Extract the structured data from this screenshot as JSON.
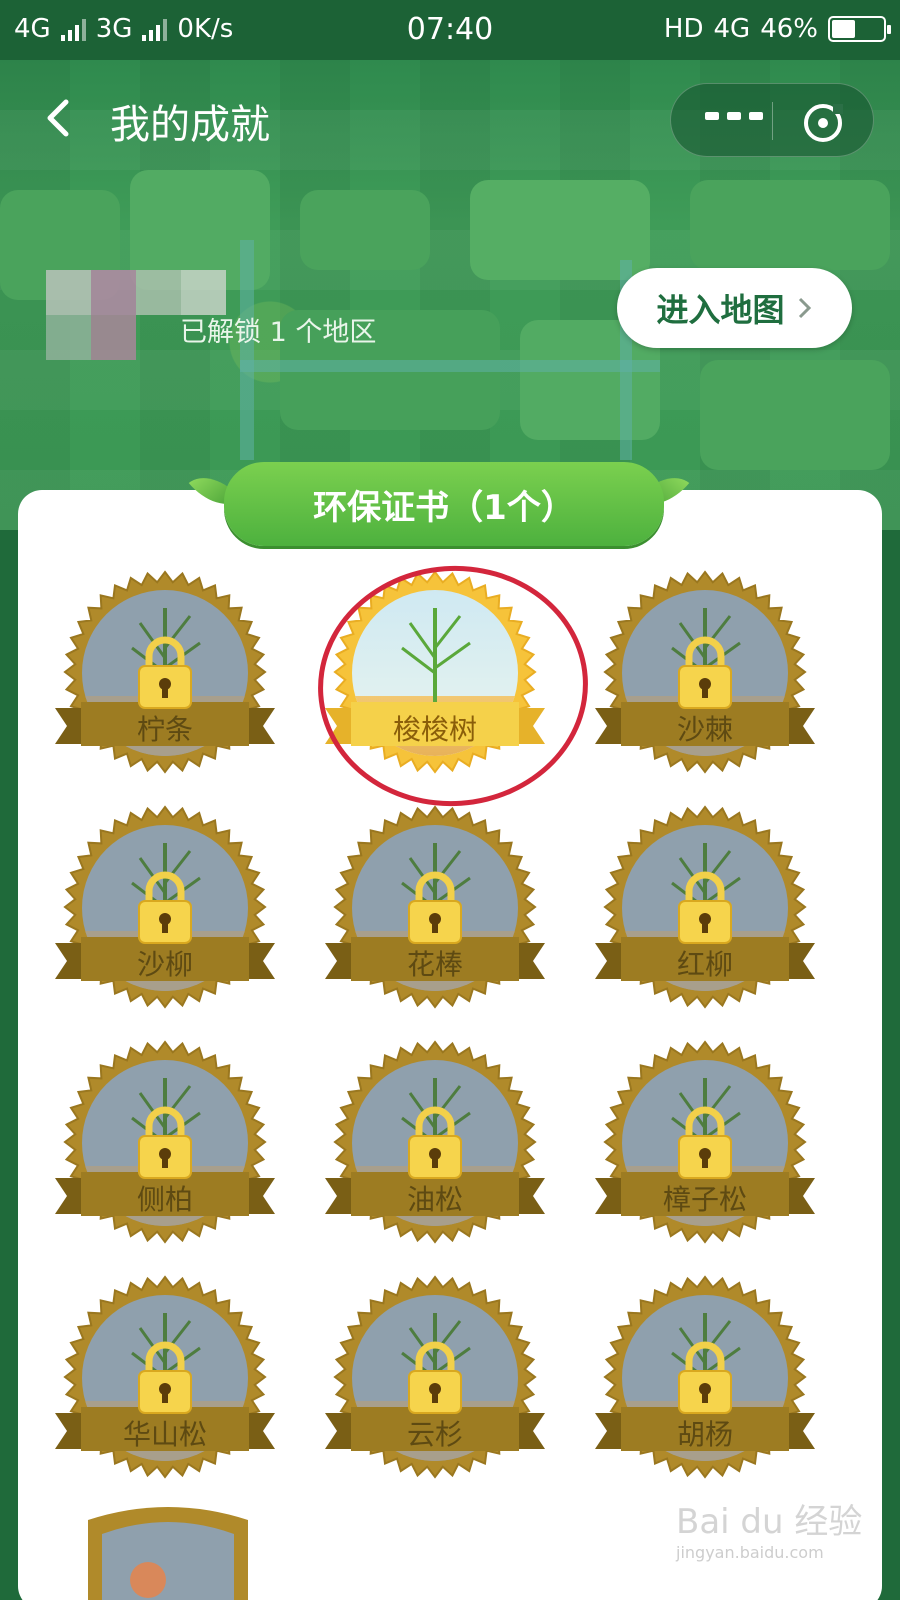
{
  "status_bar": {
    "network1": "4G",
    "network2": "3G",
    "speed": "0K/s",
    "time": "07:40",
    "hd": "HD",
    "network3": "4G",
    "battery_percent": "46%",
    "battery_level": 0.46
  },
  "nav": {
    "title": "我的成就",
    "back_icon": "chevron-left-icon",
    "more_icon": "more-icon",
    "close_icon": "target-close-icon"
  },
  "profile": {
    "unlock_text": "已解锁 1 个地区",
    "enter_map_label": "进入地图",
    "enter_map_icon": "chevron-right-icon"
  },
  "section": {
    "title": "环保证书（1个）"
  },
  "badges": [
    {
      "name": "柠条",
      "locked": true
    },
    {
      "name": "梭梭树",
      "locked": false
    },
    {
      "name": "沙棘",
      "locked": true
    },
    {
      "name": "沙柳",
      "locked": true
    },
    {
      "name": "花棒",
      "locked": true
    },
    {
      "name": "红柳",
      "locked": true
    },
    {
      "name": "侧柏",
      "locked": true
    },
    {
      "name": "油松",
      "locked": true
    },
    {
      "name": "樟子松",
      "locked": true
    },
    {
      "name": "华山松",
      "locked": true
    },
    {
      "name": "云杉",
      "locked": true
    },
    {
      "name": "胡杨",
      "locked": true
    }
  ],
  "watermark": {
    "brand": "Bai du 经验",
    "url": "jingyan.baidu.com"
  },
  "colors": {
    "header_green": "#1c6236",
    "ribbon_green": "#4db13e",
    "gold": "#b08a2a",
    "active_gold": "#f6c33a",
    "highlight_red": "#d3263c"
  }
}
